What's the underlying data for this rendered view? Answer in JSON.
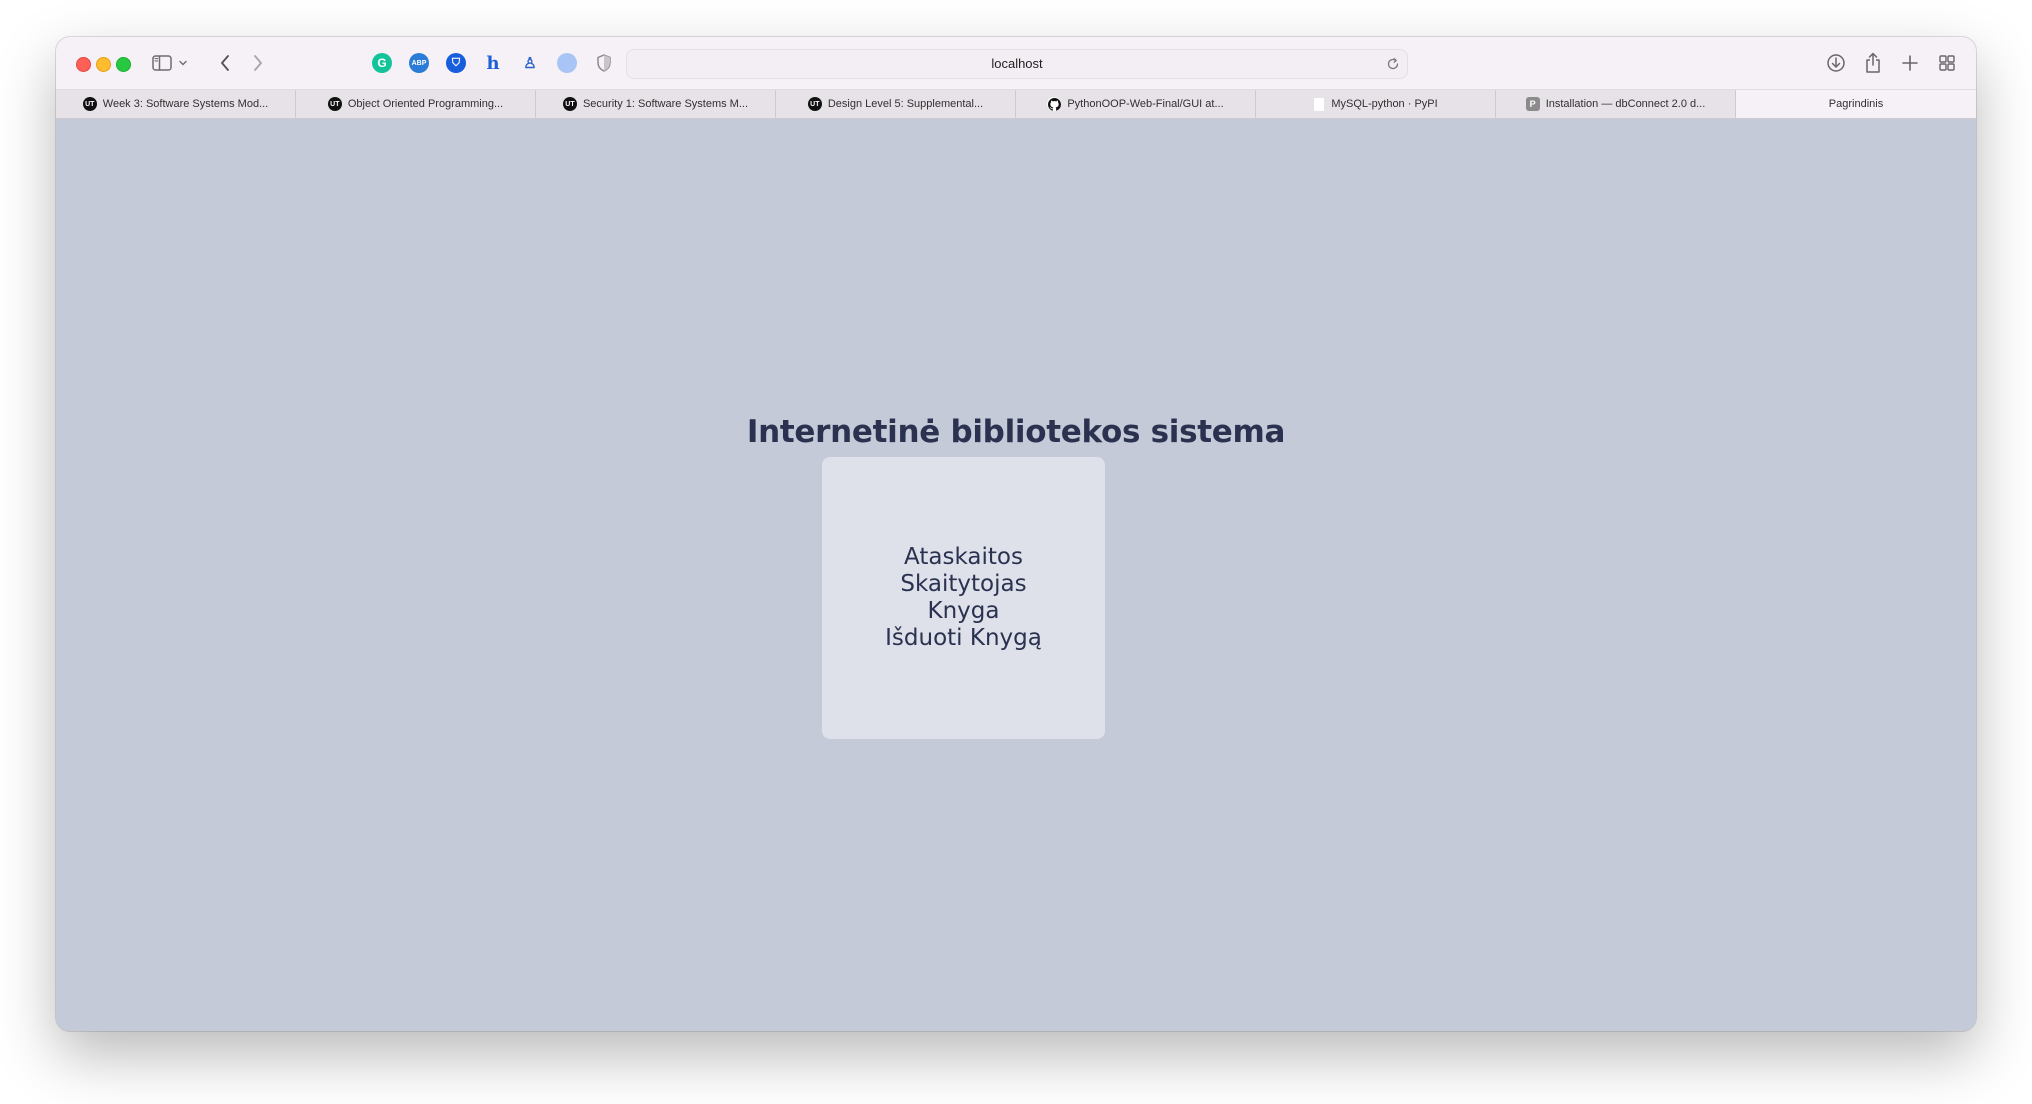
{
  "browser": {
    "url": "localhost",
    "tabs": [
      {
        "label": "Week 3: Software Systems Mod...",
        "favicon": "UT"
      },
      {
        "label": "Object Oriented Programming...",
        "favicon": "UT"
      },
      {
        "label": "Security 1: Software Systems M...",
        "favicon": "UT"
      },
      {
        "label": "Design Level 5: Supplemental...",
        "favicon": "UT"
      },
      {
        "label": "PythonOOP-Web-Final/GUI at...",
        "favicon": "github"
      },
      {
        "label": "MySQL-python · PyPI",
        "favicon": "blank"
      },
      {
        "label": "Installation — dbConnect 2.0 d...",
        "favicon": "P"
      },
      {
        "label": "Pagrindinis",
        "favicon": ""
      }
    ],
    "extensions": [
      "grammarly-icon",
      "adblock-plus-icon",
      "bitwarden-icon",
      "honey-icon",
      "ghostery-icon",
      "extension-circle-icon",
      "privacy-shield-icon"
    ]
  },
  "page": {
    "title": "Internetinė bibliotekos sistema",
    "menu": [
      {
        "label": "Ataskaitos"
      },
      {
        "label": "Skaitytojas"
      },
      {
        "label": "Knyga"
      },
      {
        "label": "Išduoti Knygą"
      }
    ]
  },
  "colors": {
    "page_background": "#c5cad8",
    "card_background": "#dee1ea",
    "text": "#2a3250"
  }
}
